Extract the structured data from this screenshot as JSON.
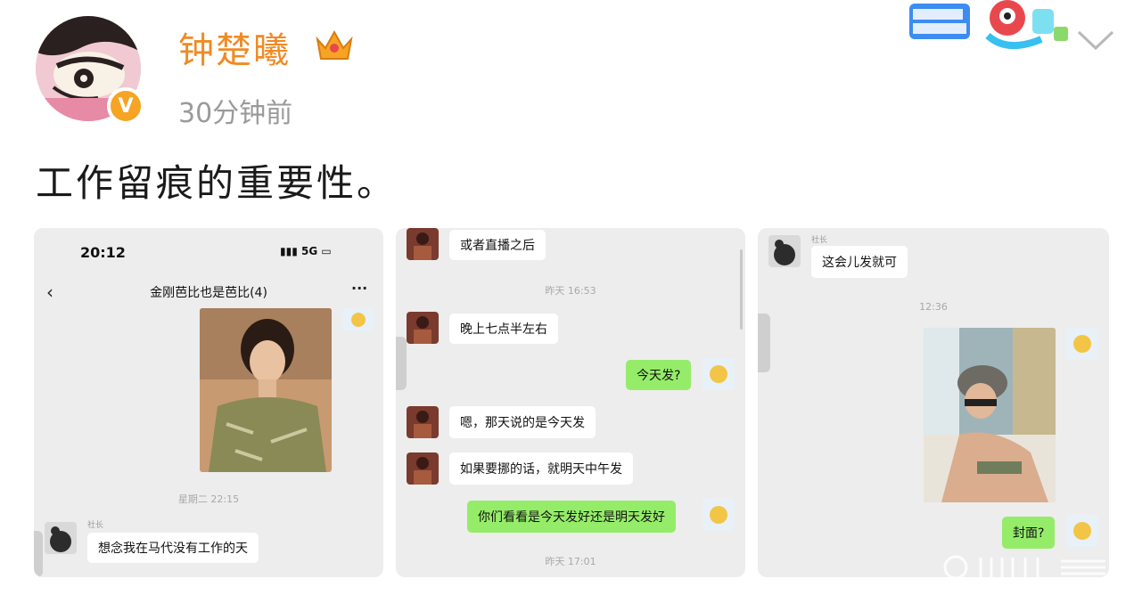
{
  "user": {
    "name": "钟楚曦",
    "time": "30分钟前",
    "verified_mark": "V"
  },
  "post": {
    "text": "工作留痕的重要性。"
  },
  "screenshots": {
    "one": {
      "status_time": "20:12",
      "status_signal": "5G",
      "chat_title": "金刚芭比也是芭比(4)",
      "timestamp": "星期二 22:15",
      "nickname": "社长",
      "message": "想念我在马代没有工作的天"
    },
    "two": {
      "msg1": "或者直播之后",
      "ts1": "昨天 16:53",
      "msg2": "晚上七点半左右",
      "msg3": "今天发?",
      "msg4": "嗯，那天说的是今天发",
      "msg5": "如果要挪的话，就明天中午发",
      "msg6": "你们看看是今天发好还是明天发好",
      "ts2": "昨天 17:01"
    },
    "three": {
      "nickname": "社长",
      "msg1": "这会儿发就可",
      "ts1": "12:36",
      "msg2": "封面?"
    }
  },
  "colors": {
    "username": "#f08a24",
    "green_bubble": "#95ec69",
    "panel_bg": "#ededed",
    "badge": "#f7a323"
  }
}
